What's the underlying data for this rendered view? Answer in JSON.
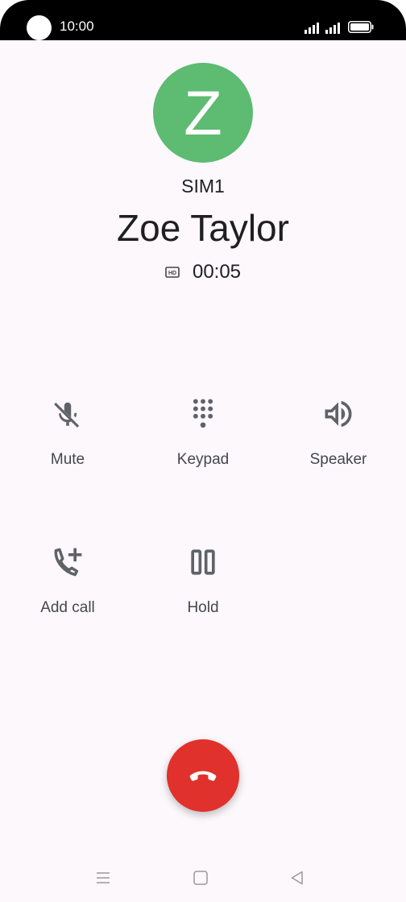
{
  "status_bar": {
    "time": "10:00"
  },
  "contact": {
    "initial": "Z",
    "sim": "SIM1",
    "name": "Zoe Taylor"
  },
  "call": {
    "duration": "00:05"
  },
  "controls": {
    "mute": "Mute",
    "keypad": "Keypad",
    "speaker": "Speaker",
    "add_call": "Add call",
    "hold": "Hold"
  },
  "colors": {
    "avatar": "#5dbb72",
    "end_call": "#e0312c",
    "icon": "#5f6368",
    "background": "#fcf8fc"
  },
  "icons": [
    "mic-off-icon",
    "dialpad-icon",
    "volume-up-icon",
    "add-call-icon",
    "pause-icon",
    "call-end-icon",
    "hd-icon"
  ]
}
